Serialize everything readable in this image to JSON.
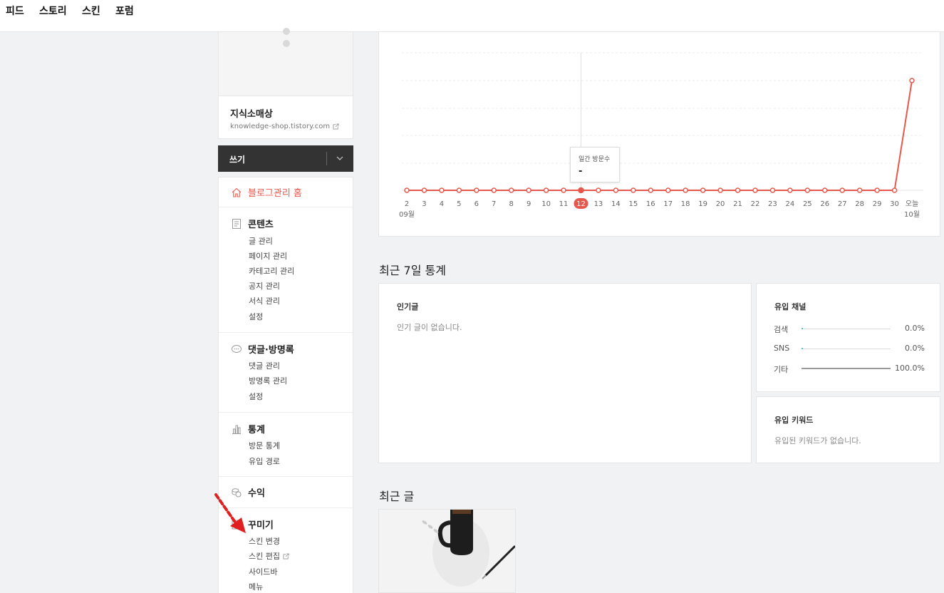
{
  "topnav": {
    "items": [
      "피드",
      "스토리",
      "스킨",
      "포럼"
    ]
  },
  "blog": {
    "name": "지식소매상",
    "url": "knowledge-shop.tistory.com"
  },
  "write": {
    "label": "쓰기"
  },
  "menu": {
    "home": "블로그관리 홈",
    "content": {
      "title": "콘텐츠",
      "items": [
        "글 관리",
        "페이지 관리",
        "카테고리 관리",
        "공지 관리",
        "서식 관리",
        "설정"
      ]
    },
    "comments": {
      "title": "댓글·방명록",
      "items": [
        "댓글 관리",
        "방명록 관리",
        "설정"
      ]
    },
    "stats": {
      "title": "통계",
      "items": [
        "방문 통계",
        "유입 경로"
      ]
    },
    "revenue": {
      "title": "수익"
    },
    "decorate": {
      "title": "꾸미기",
      "items": [
        "스킨 변경",
        "스킨 편집",
        "사이드바",
        "메뉴"
      ]
    }
  },
  "chart_data": {
    "type": "line",
    "x": [
      "2",
      "3",
      "4",
      "5",
      "6",
      "7",
      "8",
      "9",
      "10",
      "11",
      "12",
      "13",
      "14",
      "15",
      "16",
      "17",
      "18",
      "19",
      "20",
      "21",
      "22",
      "23",
      "24",
      "25",
      "26",
      "27",
      "28",
      "29",
      "30",
      "오늘"
    ],
    "month_labels": {
      "start": "09월",
      "end": "10월"
    },
    "values": [
      0,
      0,
      0,
      0,
      0,
      0,
      0,
      0,
      0,
      0,
      0,
      0,
      0,
      0,
      0,
      0,
      0,
      0,
      0,
      0,
      0,
      0,
      0,
      0,
      0,
      0,
      0,
      0,
      0,
      1
    ],
    "highlight_index": 10,
    "gridlines": true,
    "color": "#e8574b",
    "tooltip": {
      "title": "일간 방문수",
      "value": "-"
    }
  },
  "recent7": {
    "title": "최근 7일 통계",
    "popular": {
      "title": "인기글",
      "empty": "인기 글이 없습니다."
    },
    "channels": {
      "title": "유입 채널",
      "rows": [
        {
          "label": "검색",
          "pct": "0.0%",
          "value": 0.0
        },
        {
          "label": "SNS",
          "pct": "0.0%",
          "value": 0.0
        },
        {
          "label": "기타",
          "pct": "100.0%",
          "value": 1.0
        }
      ]
    },
    "keywords": {
      "title": "유입 키워드",
      "empty": "유입된 키워드가 없습니다."
    }
  },
  "recent_posts": {
    "title": "최근 글"
  }
}
